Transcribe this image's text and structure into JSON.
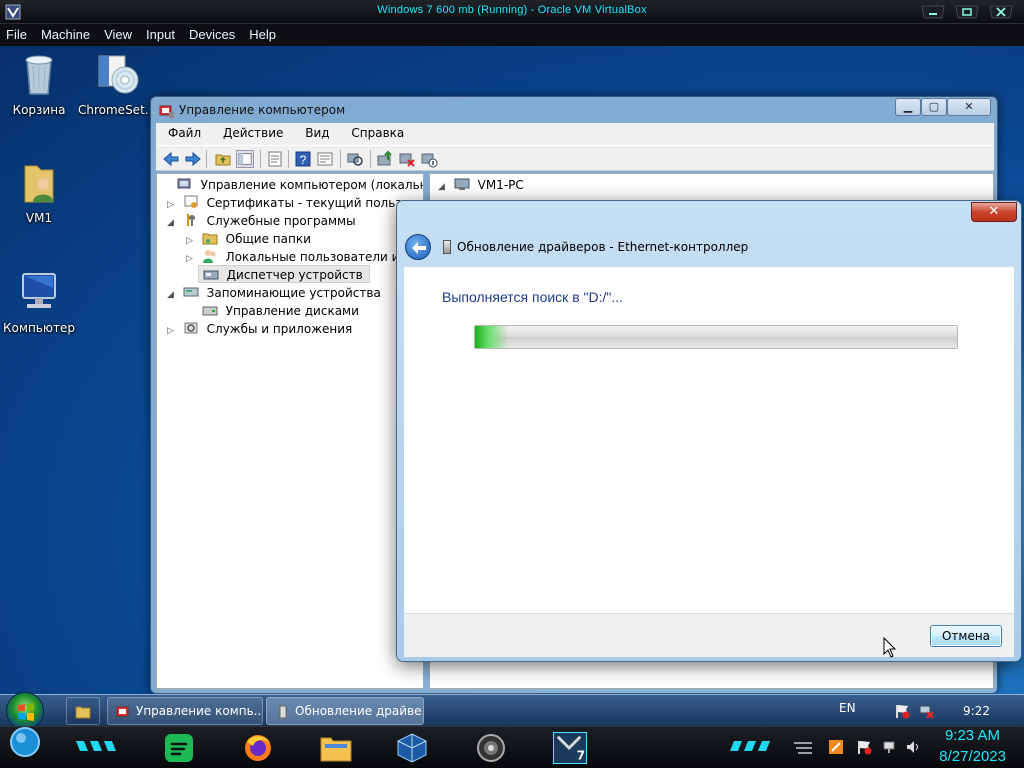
{
  "host": {
    "title": "Windows 7 600 mb (Running) - Oracle VM VirtualBox",
    "menu": [
      "File",
      "Machine",
      "View",
      "Input",
      "Devices",
      "Help"
    ]
  },
  "desktop": {
    "icons": [
      {
        "label": "Корзина",
        "icon": "recycle-bin-icon"
      },
      {
        "label": "ChromeSet...",
        "icon": "installer-disc-icon"
      },
      {
        "label": "VM1",
        "icon": "user-folder-icon"
      },
      {
        "label": "Компьютер",
        "icon": "computer-icon"
      }
    ]
  },
  "cm_window": {
    "title": "Управление компьютером",
    "menu": [
      "Файл",
      "Действие",
      "Вид",
      "Справка"
    ],
    "tree": [
      {
        "label": "Управление компьютером (локальным)",
        "level": 0,
        "expander": ""
      },
      {
        "label": "Сертификаты - текущий пользователь",
        "level": 1,
        "expander": "▷"
      },
      {
        "label": "Служебные программы",
        "level": 1,
        "expander": "◢"
      },
      {
        "label": "Общие папки",
        "level": 2,
        "expander": "▷"
      },
      {
        "label": "Локальные пользователи и группы",
        "level": 2,
        "expander": "▷"
      },
      {
        "label": "Диспетчер устройств",
        "level": 2,
        "expander": "",
        "selected": true
      },
      {
        "label": "Запоминающие устройства",
        "level": 1,
        "expander": "◢"
      },
      {
        "label": "Управление дисками",
        "level": 2,
        "expander": ""
      },
      {
        "label": "Службы и приложения",
        "level": 1,
        "expander": "▷"
      }
    ],
    "right_root": "VM1-PC",
    "right_root_expander": "◢"
  },
  "dialog": {
    "close_glyph": "✕",
    "header": "Обновление драйверов - Ethernet-контроллер",
    "status": "Выполняется поиск в \"D:/\"...",
    "progress_percent": 7,
    "cancel_label": "Отмена"
  },
  "taskbar": {
    "tasks": [
      {
        "label": "Управление компь...",
        "icon": "computer-management-icon"
      },
      {
        "label": "Обновление драйве...",
        "icon": "driver-update-icon"
      }
    ],
    "lang": "EN",
    "clock": "9:22"
  },
  "dock": {
    "time": "9:23 AM",
    "date": "8/27/2023"
  },
  "colors": {
    "host_accent": "#20e6ff",
    "progress_green": "#17b41c",
    "dialog_text_blue": "#1e3c8c"
  }
}
